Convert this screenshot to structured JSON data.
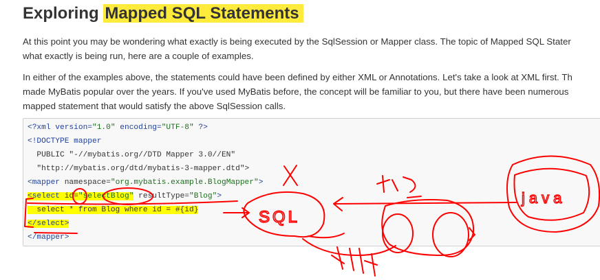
{
  "heading": {
    "prefix": "Exploring ",
    "highlighted": "Mapped SQL Statements"
  },
  "paragraphs": [
    {
      "line1": "At this point you may be wondering what exactly is being executed by the SqlSession or Mapper class. The topic of Mapped SQL Stater",
      "line2": "what exactly is being run, here are a couple of examples."
    },
    {
      "line1": "In either of the examples above, the statements could have been defined by either XML or Annotations. Let's take a look at XML first. Th",
      "line2": "made MyBatis popular over the years. If you've used MyBatis before, the concept will be familiar to you, but there have been numerous",
      "line3": "mapped statement that would satisfy the above SqlSession calls."
    }
  ],
  "code": {
    "l1_a": "<?xml version=",
    "l1_b": "\"1.0\"",
    "l1_c": " encoding=",
    "l1_d": "\"UTF-8\"",
    "l1_e": " ?>",
    "l2": "<!DOCTYPE mapper",
    "l3": "  PUBLIC \"-//mybatis.org//DTD Mapper 3.0//EN\"",
    "l4": "  \"http://mybatis.org/dtd/mybatis-3-mapper.dtd\">",
    "l5_a": "<mapper",
    "l5_b": " namespace=",
    "l5_c": "\"org.mybatis.example.BlogMapper\"",
    "l5_d": ">",
    "l6_a": "<select",
    "l6_b": " id=",
    "l6_c": "\"selectBlog\"",
    "l6_d": " resultType=",
    "l6_e": "\"Blog\"",
    "l6_f": ">",
    "l7": "  select * from Blog where id = #{id}",
    "l8": "</select>",
    "l9": "</mapper>"
  },
  "annotations": {
    "sql_label": "SQL",
    "java_label": "java",
    "x_mark": "X"
  },
  "colors": {
    "highlight": "#ffeb3b",
    "marker_red": "#ff0000",
    "code_tag": "#1f3f9a",
    "code_value": "#1b6f1b",
    "code_bg": "#f8f8f8"
  }
}
